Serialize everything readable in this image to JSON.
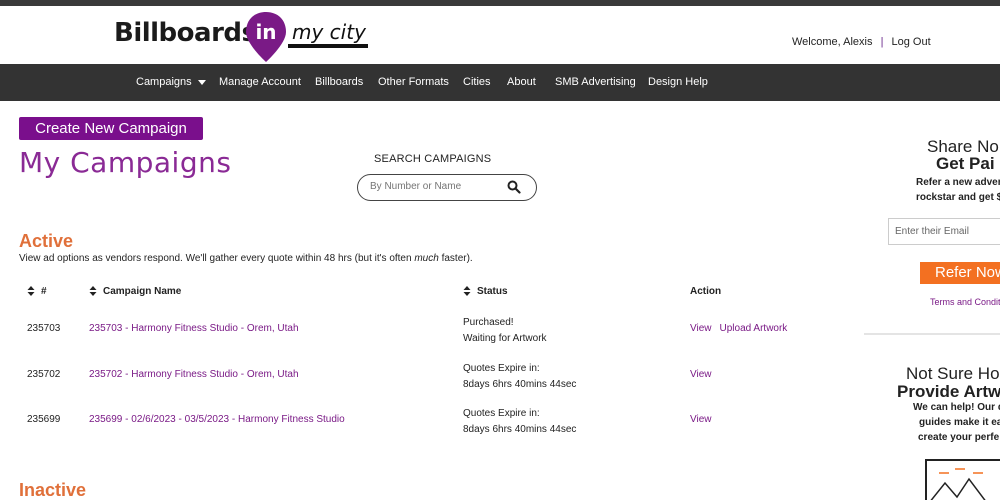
{
  "header": {
    "logo": {
      "billboards": "Billboards",
      "in": "in",
      "city": "my city"
    },
    "welcome_label": "Welcome,",
    "user_name": "Alexis",
    "separator": "|",
    "logout": "Log Out"
  },
  "nav": {
    "items": [
      {
        "label": "Campaigns"
      },
      {
        "label": "Manage Account"
      },
      {
        "label": "Billboards"
      },
      {
        "label": "Other Formats"
      },
      {
        "label": "Cities"
      },
      {
        "label": "About"
      },
      {
        "label": "SMB Advertising"
      },
      {
        "label": "Design Help"
      }
    ]
  },
  "main": {
    "create_button": "Create New Campaign",
    "title": "My Campaigns",
    "search": {
      "label": "SEARCH CAMPAIGNS",
      "placeholder": "By Number or Name"
    },
    "active": {
      "heading": "Active",
      "description_pre": "View ad options as vendors respond. We'll gather every quote within 48 hrs (but it's often ",
      "description_em": "much",
      "description_post": " faster)."
    },
    "table": {
      "headers": {
        "number": "#",
        "name": "Campaign Name",
        "status": "Status",
        "action": "Action"
      },
      "rows": [
        {
          "number": "235703",
          "name": "235703 - Harmony Fitness Studio - Orem, Utah",
          "status1": "Purchased!",
          "status2": "Waiting for Artwork",
          "actions": [
            "View",
            "Upload Artwork"
          ]
        },
        {
          "number": "235702",
          "name": "235702 - Harmony Fitness Studio - Orem, Utah",
          "status1": "Quotes Expire in:",
          "status2": "8days 6hrs 40mins 44sec",
          "actions": [
            "View"
          ]
        },
        {
          "number": "235699",
          "name": "235699 - 02/6/2023 - 03/5/2023 - Harmony Fitness Studio",
          "status1": "Quotes Expire in:",
          "status2": "8days 6hrs 40mins 44sec",
          "actions": [
            "View"
          ]
        }
      ]
    },
    "inactive": {
      "heading": "Inactive"
    }
  },
  "sidebar": {
    "share_title1": "Share No",
    "share_title2": "Get Pai",
    "share_text1": "Refer a new adver",
    "share_text2": "rockstar and get $",
    "email_placeholder": "Enter their Email",
    "refer_button": "Refer Now",
    "terms": "Terms and Conditi",
    "artwork_title1": "Not Sure Ho",
    "artwork_title2": "Provide Artw",
    "artwork_text1": "We can help! Our d",
    "artwork_text2": "guides make it ea",
    "artwork_text3": "create your perfe"
  },
  "colors": {
    "brand_purple": "#7a0f8c",
    "accent_orange": "#f37021",
    "heading_orange": "#e0703a",
    "nav_bg": "#333333"
  }
}
